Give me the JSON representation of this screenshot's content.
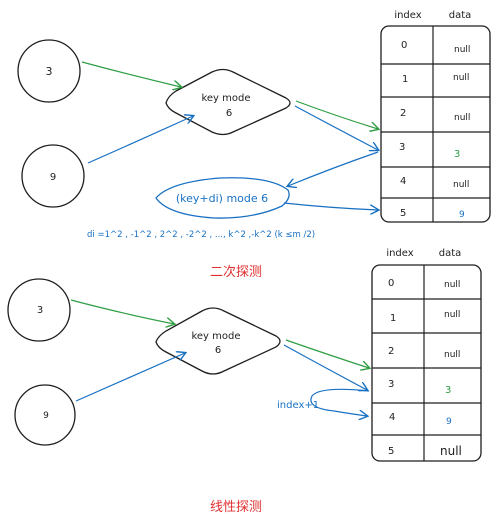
{
  "colors": {
    "green": "#2f9e44",
    "blue": "#1971c2",
    "red": "#e03131",
    "ink": "#1e1e1e"
  },
  "quadratic": {
    "key_a": "3",
    "key_b": "9",
    "hash": "key mode 6",
    "hash_line1": "key mode",
    "hash_line2": "6",
    "probe": "(key+di) mode 6",
    "di_formula": "di =1^2 , -1^2 , 2^2 , -2^2 , ..., k^2 ,-k^2   (k ≤m /2)",
    "caption": "二次探测",
    "table": {
      "index_header": "index",
      "data_header": "data",
      "rows": [
        {
          "index": "0",
          "data": "null"
        },
        {
          "index": "1",
          "data": "null"
        },
        {
          "index": "2",
          "data": "null"
        },
        {
          "index": "3",
          "data": "3"
        },
        {
          "index": "4",
          "data": "null"
        },
        {
          "index": "5",
          "data": "9"
        }
      ]
    }
  },
  "linear": {
    "key_a": "3",
    "key_b": "9",
    "hash_line1": "key mode",
    "hash_line2": "6",
    "probe_label": "index+1",
    "caption": "线性探测",
    "table": {
      "index_header": "index",
      "data_header": "data",
      "rows": [
        {
          "index": "0",
          "data": "null"
        },
        {
          "index": "1",
          "data": "null"
        },
        {
          "index": "2",
          "data": "null"
        },
        {
          "index": "3",
          "data": "3"
        },
        {
          "index": "4",
          "data": "9"
        },
        {
          "index": "5",
          "data": "null"
        }
      ]
    }
  }
}
